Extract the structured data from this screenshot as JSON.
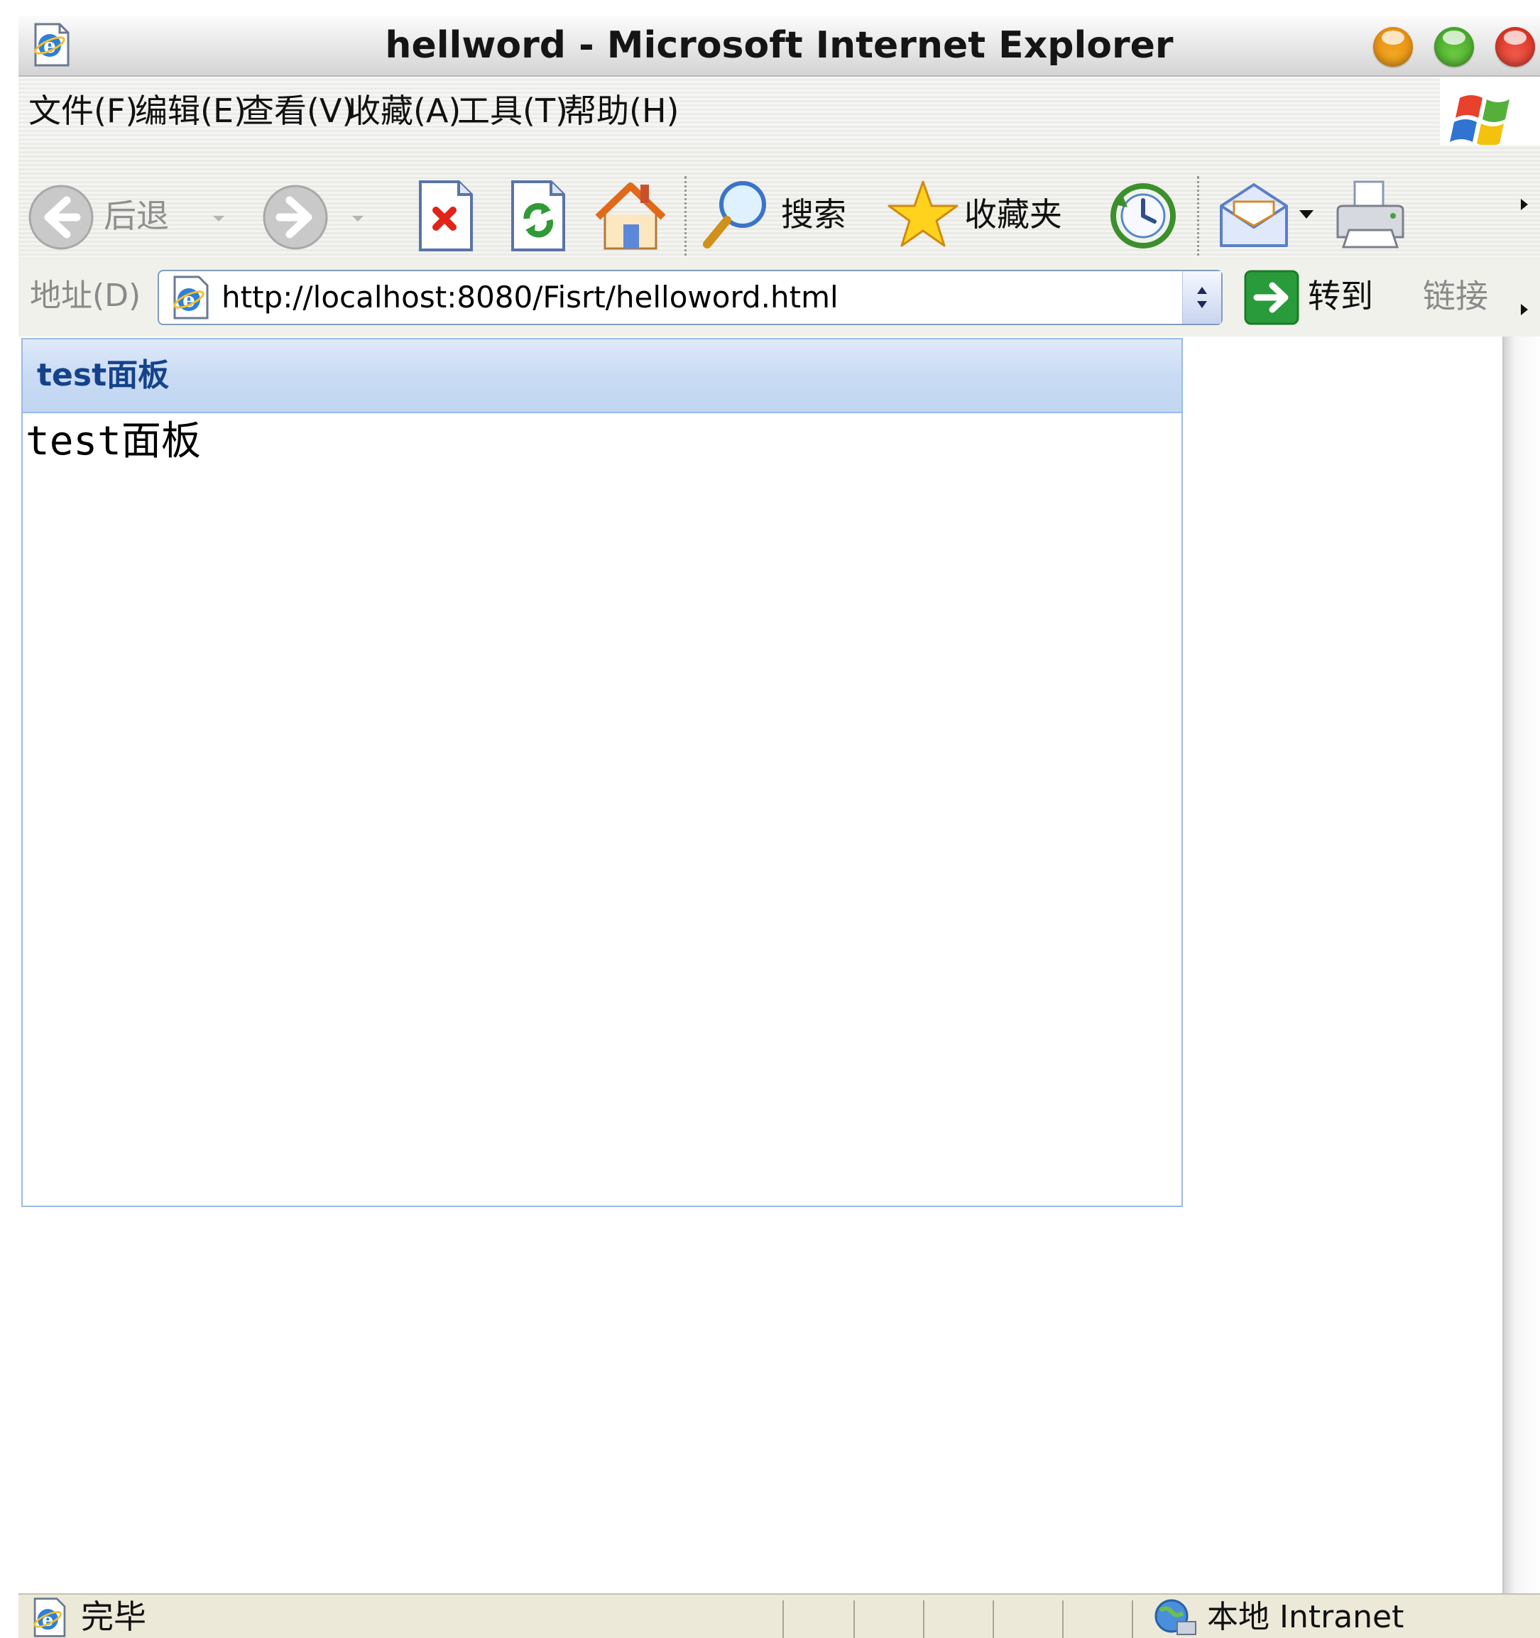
{
  "window": {
    "title": "hellword - Microsoft Internet Explorer"
  },
  "menu": [
    {
      "label": "文件(F)"
    },
    {
      "label": "编辑(E)"
    },
    {
      "label": "查看(V)"
    },
    {
      "label": "收藏(A)"
    },
    {
      "label": "工具(T)"
    },
    {
      "label": "帮助(H)"
    }
  ],
  "toolbar": {
    "back_label": "后退",
    "search_label": "搜索",
    "favorites_label": "收藏夹"
  },
  "address": {
    "label": "地址(D)",
    "url": "http://localhost:8080/Fisrt/helloword.html",
    "go_label": "转到",
    "links_label": "链接"
  },
  "panel": {
    "title": "test面板",
    "body": "test面板"
  },
  "status": {
    "text": "完毕",
    "zone": "本地 Intranet"
  },
  "colors": {
    "panel_border": "#99bbe8",
    "panel_title": "#15428b",
    "go_green": "#2a9b3a"
  }
}
